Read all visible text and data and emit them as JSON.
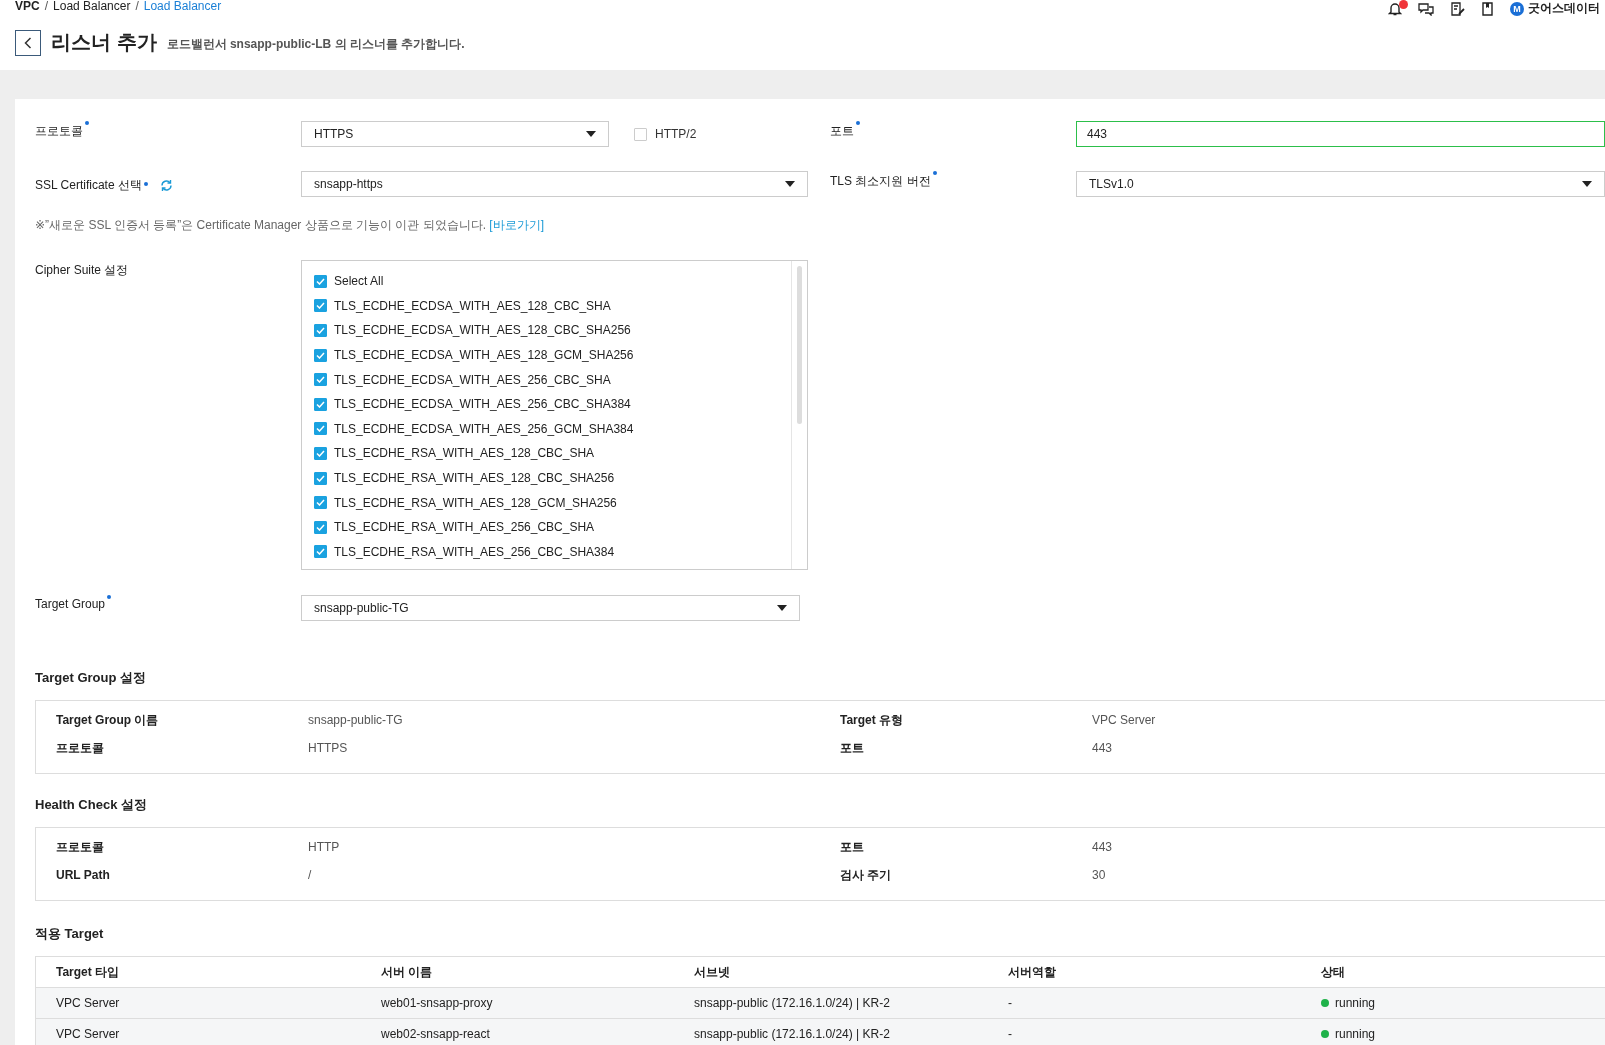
{
  "breadcrumb": {
    "separator": "/",
    "items": [
      "VPC",
      "Load Balancer",
      "Load Balancer"
    ]
  },
  "user": {
    "avatar": "M",
    "name": "굿어스데이터"
  },
  "page": {
    "title": "리스너 추가",
    "subtitle": "로드밸런서 snsapp-public-LB 의 리스너를 추가합니다."
  },
  "protocol": {
    "label": "프로토콜",
    "required": true,
    "value": "HTTPS"
  },
  "http2": {
    "label": "HTTP/2",
    "checked": false
  },
  "port": {
    "label": "포트",
    "required": true,
    "value": "443",
    "focused": true
  },
  "ssl_certificate": {
    "label": "SSL Certificate 선택",
    "required": true,
    "value": "snsapp-https"
  },
  "tls_min_version": {
    "label": "TLS 최소지원 버전",
    "required": true,
    "value": "TLSv1.0"
  },
  "notice": {
    "text": "※”새로운 SSL 인증서 등록”은 Certificate Manager 상품으로 기능이 이관 되었습니다.",
    "link": "[바로가기]"
  },
  "cipher_suites": {
    "label": "Cipher Suite 설정",
    "items": [
      {
        "label": "Select All",
        "checked": true
      },
      {
        "label": "TLS_ECDHE_ECDSA_WITH_AES_128_CBC_SHA",
        "checked": true
      },
      {
        "label": "TLS_ECDHE_ECDSA_WITH_AES_128_CBC_SHA256",
        "checked": true
      },
      {
        "label": "TLS_ECDHE_ECDSA_WITH_AES_128_GCM_SHA256",
        "checked": true
      },
      {
        "label": "TLS_ECDHE_ECDSA_WITH_AES_256_CBC_SHA",
        "checked": true
      },
      {
        "label": "TLS_ECDHE_ECDSA_WITH_AES_256_CBC_SHA384",
        "checked": true
      },
      {
        "label": "TLS_ECDHE_ECDSA_WITH_AES_256_GCM_SHA384",
        "checked": true
      },
      {
        "label": "TLS_ECDHE_RSA_WITH_AES_128_CBC_SHA",
        "checked": true
      },
      {
        "label": "TLS_ECDHE_RSA_WITH_AES_128_CBC_SHA256",
        "checked": true
      },
      {
        "label": "TLS_ECDHE_RSA_WITH_AES_128_GCM_SHA256",
        "checked": true
      },
      {
        "label": "TLS_ECDHE_RSA_WITH_AES_256_CBC_SHA",
        "checked": true
      },
      {
        "label": "TLS_ECDHE_RSA_WITH_AES_256_CBC_SHA384",
        "checked": true
      }
    ]
  },
  "target_group": {
    "label": "Target Group",
    "required": true,
    "value": "snsapp-public-TG"
  },
  "target_group_settings": {
    "title": "Target Group 설정",
    "fields": [
      {
        "label": "Target Group 이름",
        "value": "snsapp-public-TG"
      },
      {
        "label": "Target 유형",
        "value": "VPC Server"
      },
      {
        "label": "프로토콜",
        "value": "HTTPS"
      },
      {
        "label": "포트",
        "value": "443"
      }
    ]
  },
  "health_check": {
    "title": "Health Check 설정",
    "fields": [
      {
        "label": "프로토콜",
        "value": "HTTP"
      },
      {
        "label": "포트",
        "value": "443"
      },
      {
        "label": "URL Path",
        "value": "/"
      },
      {
        "label": "검사 주기",
        "value": "30"
      }
    ]
  },
  "targets": {
    "title": "적용 Target",
    "columns": [
      "Target 타입",
      "서버 이름",
      "서브넷",
      "서버역할",
      "상태"
    ],
    "rows": [
      {
        "cells": [
          "VPC Server",
          "web01-snsapp-proxy",
          "snsapp-public (172.16.1.0/24) | KR-2",
          "-"
        ],
        "status": "running",
        "color": "#1fb24a"
      },
      {
        "cells": [
          "VPC Server",
          "web02-snsapp-react",
          "snsapp-public (172.16.1.0/24) | KR-2",
          "-"
        ],
        "status": "running",
        "color": "#1fb24a"
      }
    ]
  }
}
